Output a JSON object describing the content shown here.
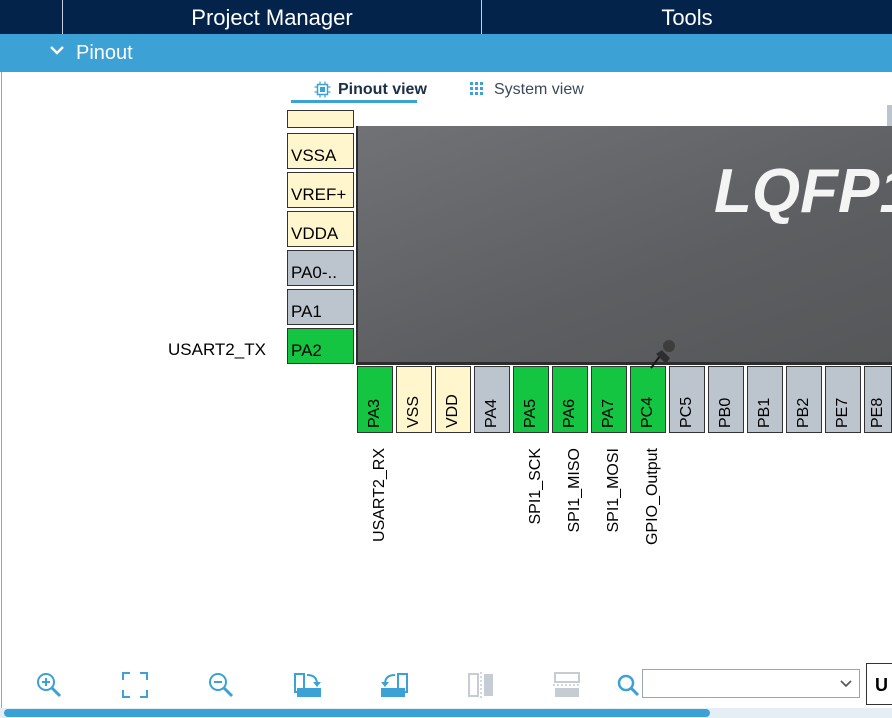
{
  "header": {
    "tabs": [
      {
        "label": "Project Manager"
      },
      {
        "label": "Tools"
      }
    ]
  },
  "section": {
    "title": "Pinout",
    "icon": "chevron-down-icon"
  },
  "view_tabs": [
    {
      "label": "Pinout view",
      "icon": "chip-icon",
      "active": true
    },
    {
      "label": "System view",
      "icon": "list-icon",
      "active": false
    }
  ],
  "chip": {
    "package_label": "LQFP1"
  },
  "left_pins": [
    {
      "name": "VSSA",
      "type": "power"
    },
    {
      "name": "VREF+",
      "type": "power"
    },
    {
      "name": "VDDA",
      "type": "power"
    },
    {
      "name": "PA0-..",
      "type": "unused"
    },
    {
      "name": "PA1",
      "type": "unused"
    },
    {
      "name": "PA2",
      "type": "assigned",
      "signal": "USART2_TX"
    }
  ],
  "bottom_pins": [
    {
      "name": "PA3",
      "type": "assigned",
      "signal": "USART2_RX"
    },
    {
      "name": "VSS",
      "type": "power",
      "signal": ""
    },
    {
      "name": "VDD",
      "type": "power",
      "signal": ""
    },
    {
      "name": "PA4",
      "type": "unused",
      "signal": ""
    },
    {
      "name": "PA5",
      "type": "assigned",
      "signal": "SPI1_SCK"
    },
    {
      "name": "PA6",
      "type": "assigned",
      "signal": "SPI1_MISO"
    },
    {
      "name": "PA7",
      "type": "assigned",
      "signal": "SPI1_MOSI"
    },
    {
      "name": "PC4",
      "type": "assigned",
      "signal": "GPIO_Output"
    },
    {
      "name": "PC5",
      "type": "unused",
      "signal": ""
    },
    {
      "name": "PB0",
      "type": "unused",
      "signal": ""
    },
    {
      "name": "PB1",
      "type": "unused",
      "signal": ""
    },
    {
      "name": "PB2",
      "type": "unused",
      "signal": ""
    },
    {
      "name": "PE7",
      "type": "unused",
      "signal": ""
    },
    {
      "name": "PE8",
      "type": "unused",
      "signal": ""
    }
  ],
  "toolbar": {
    "buttons": [
      {
        "name": "zoom-in-icon"
      },
      {
        "name": "fit-screen-icon"
      },
      {
        "name": "zoom-out-icon"
      },
      {
        "name": "rotate-right-icon"
      },
      {
        "name": "rotate-left-icon"
      },
      {
        "name": "flip-vertical-icon"
      },
      {
        "name": "flip-horizontal-icon"
      }
    ],
    "search_icon": "search-icon",
    "search_value": "",
    "u_button_label": "U"
  },
  "colors": {
    "header_bg": "#03234b",
    "section_bg": "#3ca1d5",
    "pin_assigned": "#13c540",
    "pin_power": "#fff6ce",
    "pin_unused": "#bcc5ce",
    "chip_body": "#636568"
  }
}
